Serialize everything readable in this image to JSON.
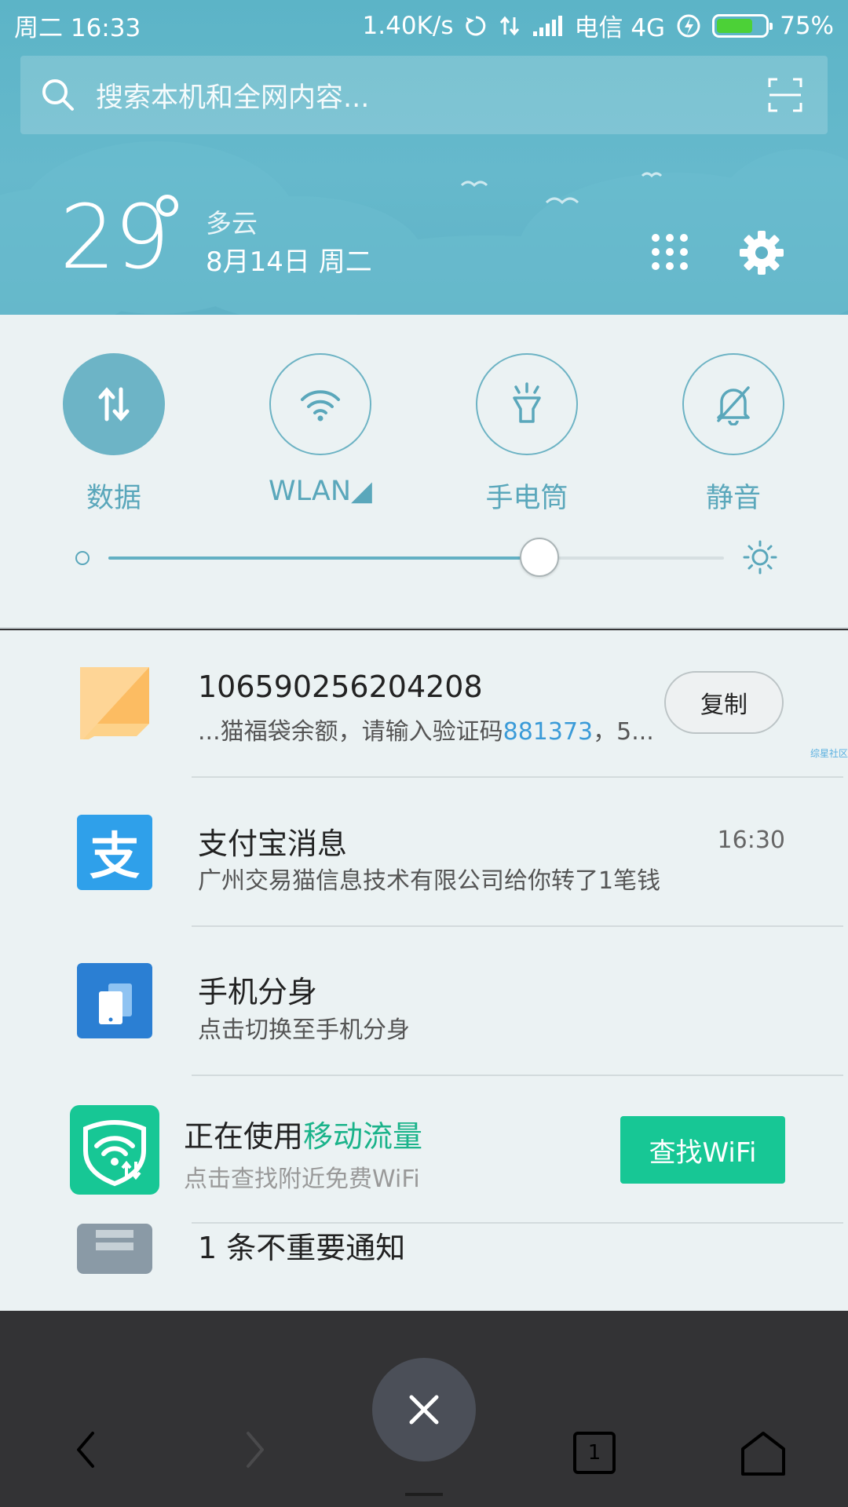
{
  "statusbar": {
    "day_time": "周二  16:33",
    "speed": "1.40K/s",
    "carrier": "电信 4G",
    "battery_percent": "75%",
    "battery_level": 0.75
  },
  "search": {
    "placeholder": "搜索本机和全网内容..."
  },
  "weather": {
    "temp": "29",
    "condition": "多云",
    "date": "8月14日 周二"
  },
  "toggles": [
    {
      "label": "数据",
      "active": true
    },
    {
      "label": "WLAN◢",
      "active": false
    },
    {
      "label": "手电筒",
      "active": false
    },
    {
      "label": "静音",
      "active": false
    }
  ],
  "brightness": {
    "level": 0.7
  },
  "notifications": {
    "sms": {
      "title": "106590256204208",
      "body_prefix": "...猫福袋余额，请输入验证码",
      "code": "881373",
      "body_suffix": "，5...",
      "copy_label": "复制",
      "watermark": "综星社区"
    },
    "alipay": {
      "icon_char": "支",
      "title": "支付宝消息",
      "time": "16:30",
      "body": "广州交易猫信息技术有限公司给你转了1笔钱"
    },
    "clone": {
      "title": "手机分身",
      "body": "点击切换至手机分身"
    },
    "wifi": {
      "title_prefix": "正在使用",
      "title_accent": "移动流量",
      "body": "点击查找附近免费WiFi",
      "button_label": "查找WiFi"
    },
    "unimportant": {
      "title": "1 条不重要通知"
    }
  },
  "nav": {
    "tabs_count": "1"
  },
  "colors": {
    "header": "#5fb2c6",
    "panel": "#ebf2f3",
    "accent_green": "#17c795",
    "link_blue": "#3b9bd8"
  }
}
